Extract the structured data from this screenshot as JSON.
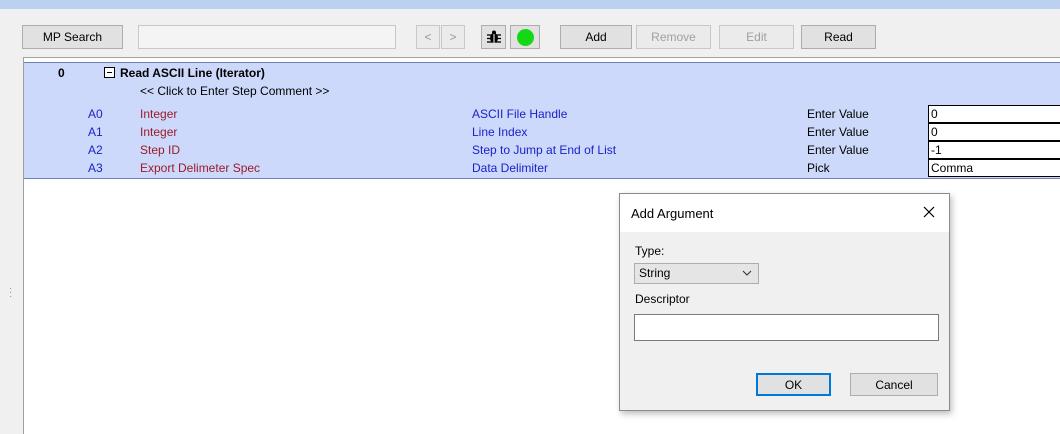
{
  "toolbar": {
    "mp_search_label": "MP Search",
    "search_value": "",
    "prev_glyph": "<",
    "next_glyph": ">",
    "add_label": "Add",
    "remove_label": "Remove",
    "edit_label": "Edit",
    "read_label": "Read",
    "status_color": "#14d814"
  },
  "step": {
    "number": "0",
    "title": "Read ASCII Line (Iterator)",
    "comment": "<< Click to Enter Step Comment >>",
    "args": [
      {
        "id": "A0",
        "type": "Integer",
        "desc": "ASCII File Handle",
        "mode": "Enter Value",
        "value": "0"
      },
      {
        "id": "A1",
        "type": "Integer",
        "desc": "Line Index",
        "mode": "Enter Value",
        "value": "0"
      },
      {
        "id": "A2",
        "type": "Step ID",
        "desc": "Step to Jump at End of List",
        "mode": "Enter Value",
        "value": "-1"
      },
      {
        "id": "A3",
        "type": "Export Delimeter Spec",
        "desc": "Data Delimiter",
        "mode": "Pick",
        "value": "Comma"
      }
    ]
  },
  "dialog": {
    "title": "Add Argument",
    "type_label": "Type:",
    "type_value": "String",
    "descriptor_label": "Descriptor",
    "descriptor_value": "",
    "ok_label": "OK",
    "cancel_label": "Cancel"
  }
}
